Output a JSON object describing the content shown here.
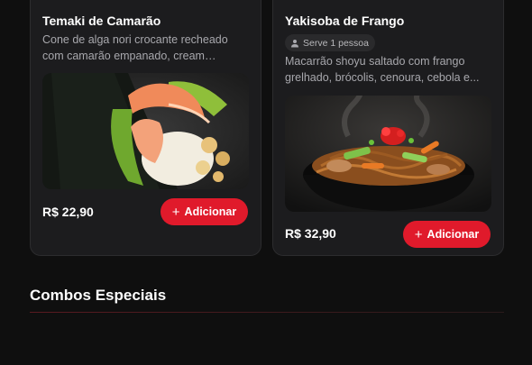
{
  "menu": {
    "items": [
      {
        "title": "Temaki de Camarão",
        "description": "Cone de alga nori crocante recheado com camarão empanado, cream cheese...",
        "price": "R$ 22,90",
        "add_label": "Adicionar",
        "image_icon": "temaki-image"
      },
      {
        "title": "Yakisoba de Frango",
        "serves": "Serve 1 pessoa",
        "description": "Macarrão shoyu saltado com frango grelhado, brócolis, cenoura, cebola e...",
        "price": "R$ 32,90",
        "add_label": "Adicionar",
        "image_icon": "yakisoba-image"
      }
    ]
  },
  "section": {
    "title": "Combos Especiais"
  },
  "colors": {
    "accent": "#e01a2b",
    "background": "#0f0f0f",
    "card": "#1c1c1e"
  }
}
